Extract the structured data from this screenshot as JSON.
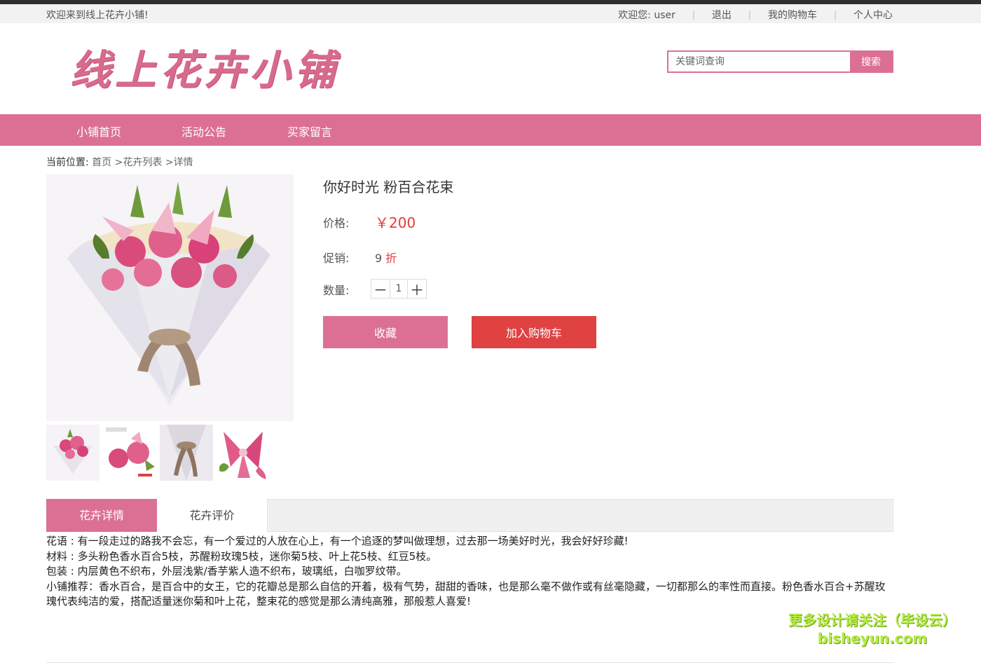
{
  "topbar": {
    "welcome": "欢迎来到线上花卉小铺!",
    "user_greeting": "欢迎您: user",
    "logout": "退出",
    "cart": "我的购物车",
    "profile": "个人中心"
  },
  "header": {
    "logo_text": "线上花卉小铺",
    "search_placeholder": "关键词查询",
    "search_button": "搜索"
  },
  "nav": {
    "items": [
      {
        "label": "小铺首页"
      },
      {
        "label": "活动公告"
      },
      {
        "label": "买家留言"
      }
    ]
  },
  "breadcrumb": {
    "prefix": "当前位置:",
    "items": [
      "首页",
      ">花卉列表",
      ">详情"
    ]
  },
  "product": {
    "title": "你好时光 粉百合花束",
    "price_label": "价格:",
    "price": "￥200",
    "promo_label": "促销:",
    "discount_value": "9",
    "discount_unit": "折",
    "qty_label": "数量:",
    "qty_minus": "－",
    "qty_value": "1",
    "qty_plus": "＋",
    "favorite_button": "收藏",
    "add_cart_button": "加入购物车"
  },
  "tabs": [
    {
      "label": "花卉详情",
      "active": true
    },
    {
      "label": "花卉评价",
      "active": false
    }
  ],
  "details": {
    "line1": "花语 : 有一段走过的路我不会忘，有一个爱过的人放在心上，有一个追逐的梦叫做理想，过去那一场美好时光，我会好好珍藏!",
    "line2": "材料 : 多头粉色香水百合5枝，苏醒粉玫瑰5枝，迷你菊5枝、叶上花5枝、红豆5枝。",
    "line3": "包装 : 内层黄色不织布，外层浅紫/香芋紫人造不织布，玻璃纸，白咖罗纹带。",
    "line4": "小铺推荐：香水百合，是百合中的女王，它的花瓣总是那么自信的开着，极有气势，甜甜的香味，也是那么毫不做作或有丝毫隐藏，一切都那么的率性而直接。粉色香水百合+苏醒玫瑰代表纯洁的爱，搭配适量迷你菊和叶上花，整束花的感觉是那么清纯高雅，那般惹人喜爱!"
  },
  "watermark": {
    "line1": "更多设计请关注（毕设云）",
    "line2": "bisheyun.com"
  },
  "colors": {
    "accent": "#dc7094",
    "price_red": "#e23b3b",
    "cart_button": "#e04141"
  }
}
